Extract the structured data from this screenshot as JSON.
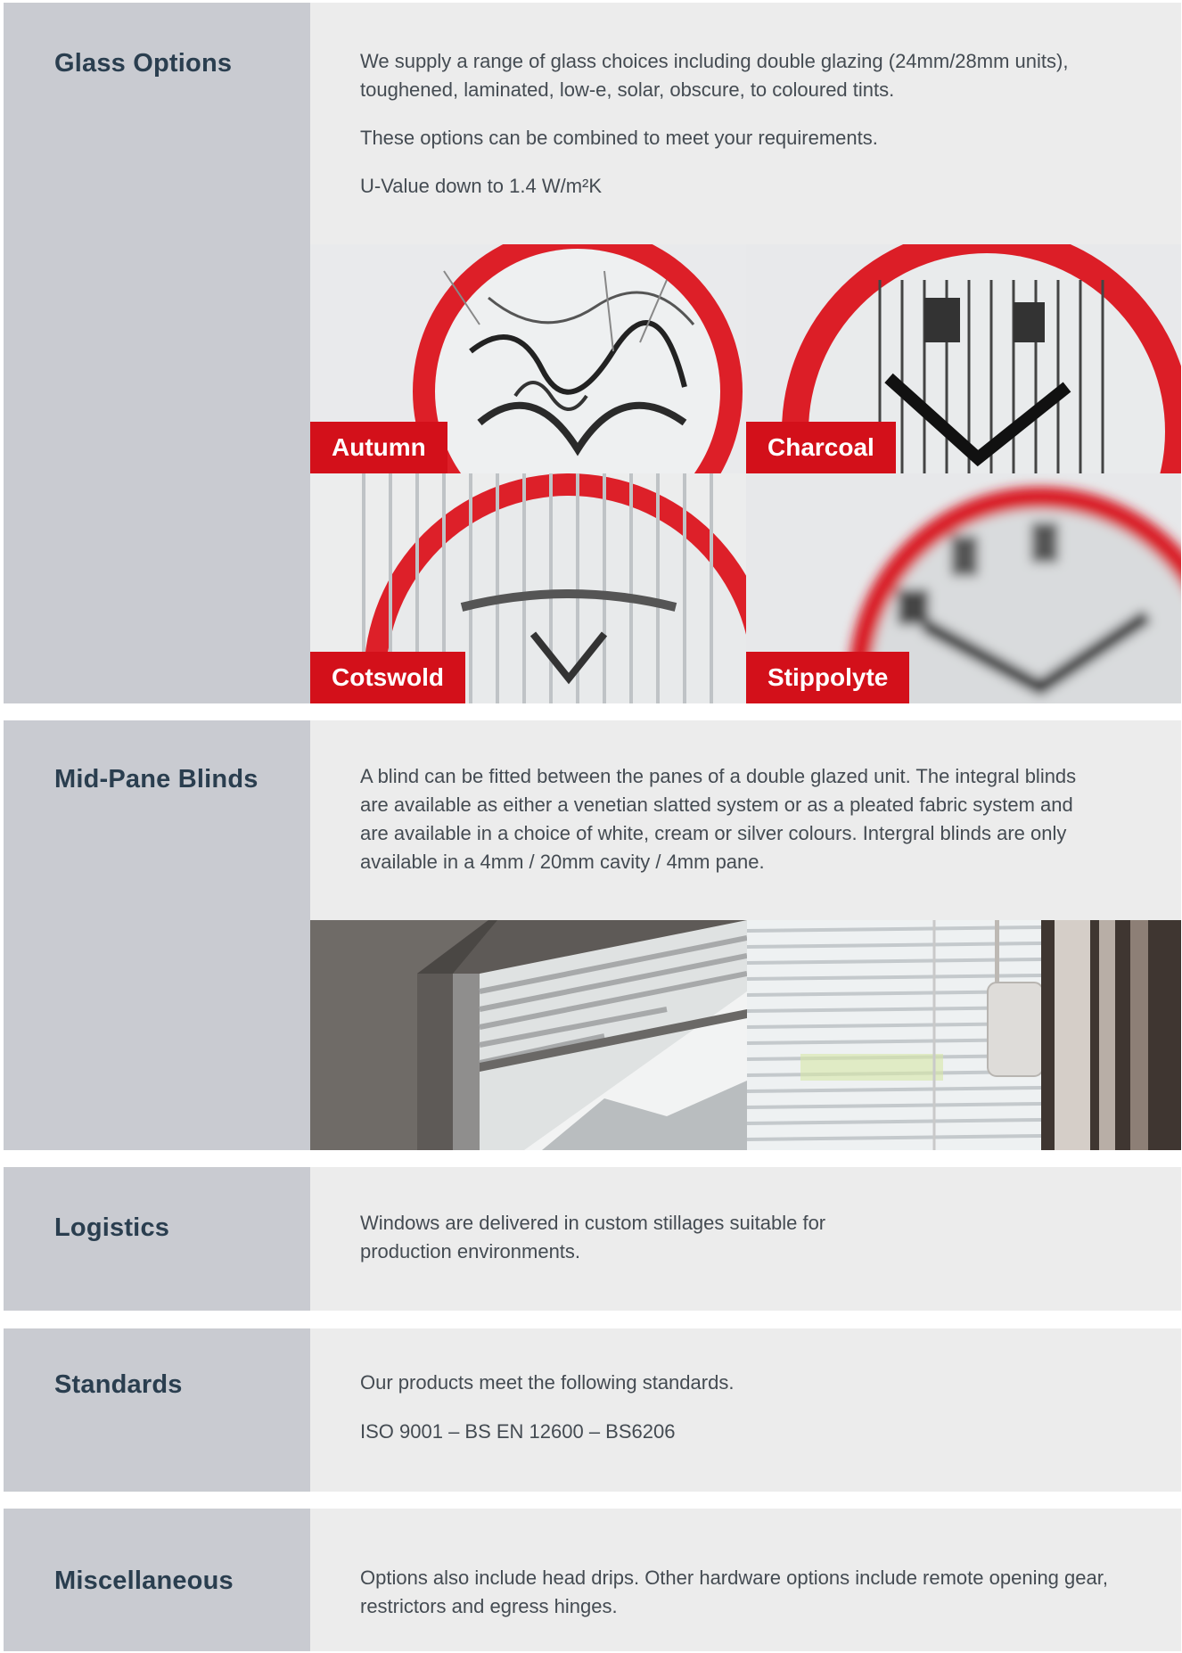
{
  "glass_options": {
    "heading": "Glass Options",
    "paragraphs": [
      "We supply a range of glass choices including double glazing (24mm/28mm units), toughened, laminated, low-e, solar, obscure, to coloured tints.",
      "These options can be combined to meet your requirements.",
      "U-Value down to 1.4 W/m²K"
    ],
    "samples": [
      "Autumn",
      "Charcoal",
      "Cotswold",
      "Stippolyte"
    ]
  },
  "mid_pane_blinds": {
    "heading": "Mid-Pane Blinds",
    "paragraph": "A blind can be fitted between the panes of a double glazed unit. The integral blinds are available as either a venetian slatted system or as a pleated fabric system and are available in a choice of white, cream or silver colours. Intergral blinds are only available in a 4mm / 20mm cavity / 4mm pane."
  },
  "logistics": {
    "heading": "Logistics",
    "paragraph": "Windows are delivered in custom stillages suitable for production environments."
  },
  "standards": {
    "heading": "Standards",
    "paragraphs": [
      "Our products meet the following standards.",
      "ISO 9001 – BS EN 12600 – BS6206"
    ]
  },
  "miscellaneous": {
    "heading": "Miscellaneous",
    "paragraph": "Options also include head drips. Other hardware options include remote opening gear, restrictors and egress hinges."
  },
  "colors": {
    "sidebar": "#c9cbd1",
    "content": "#ececec",
    "heading": "#2a3e4f",
    "label_red": "#d3101a"
  }
}
